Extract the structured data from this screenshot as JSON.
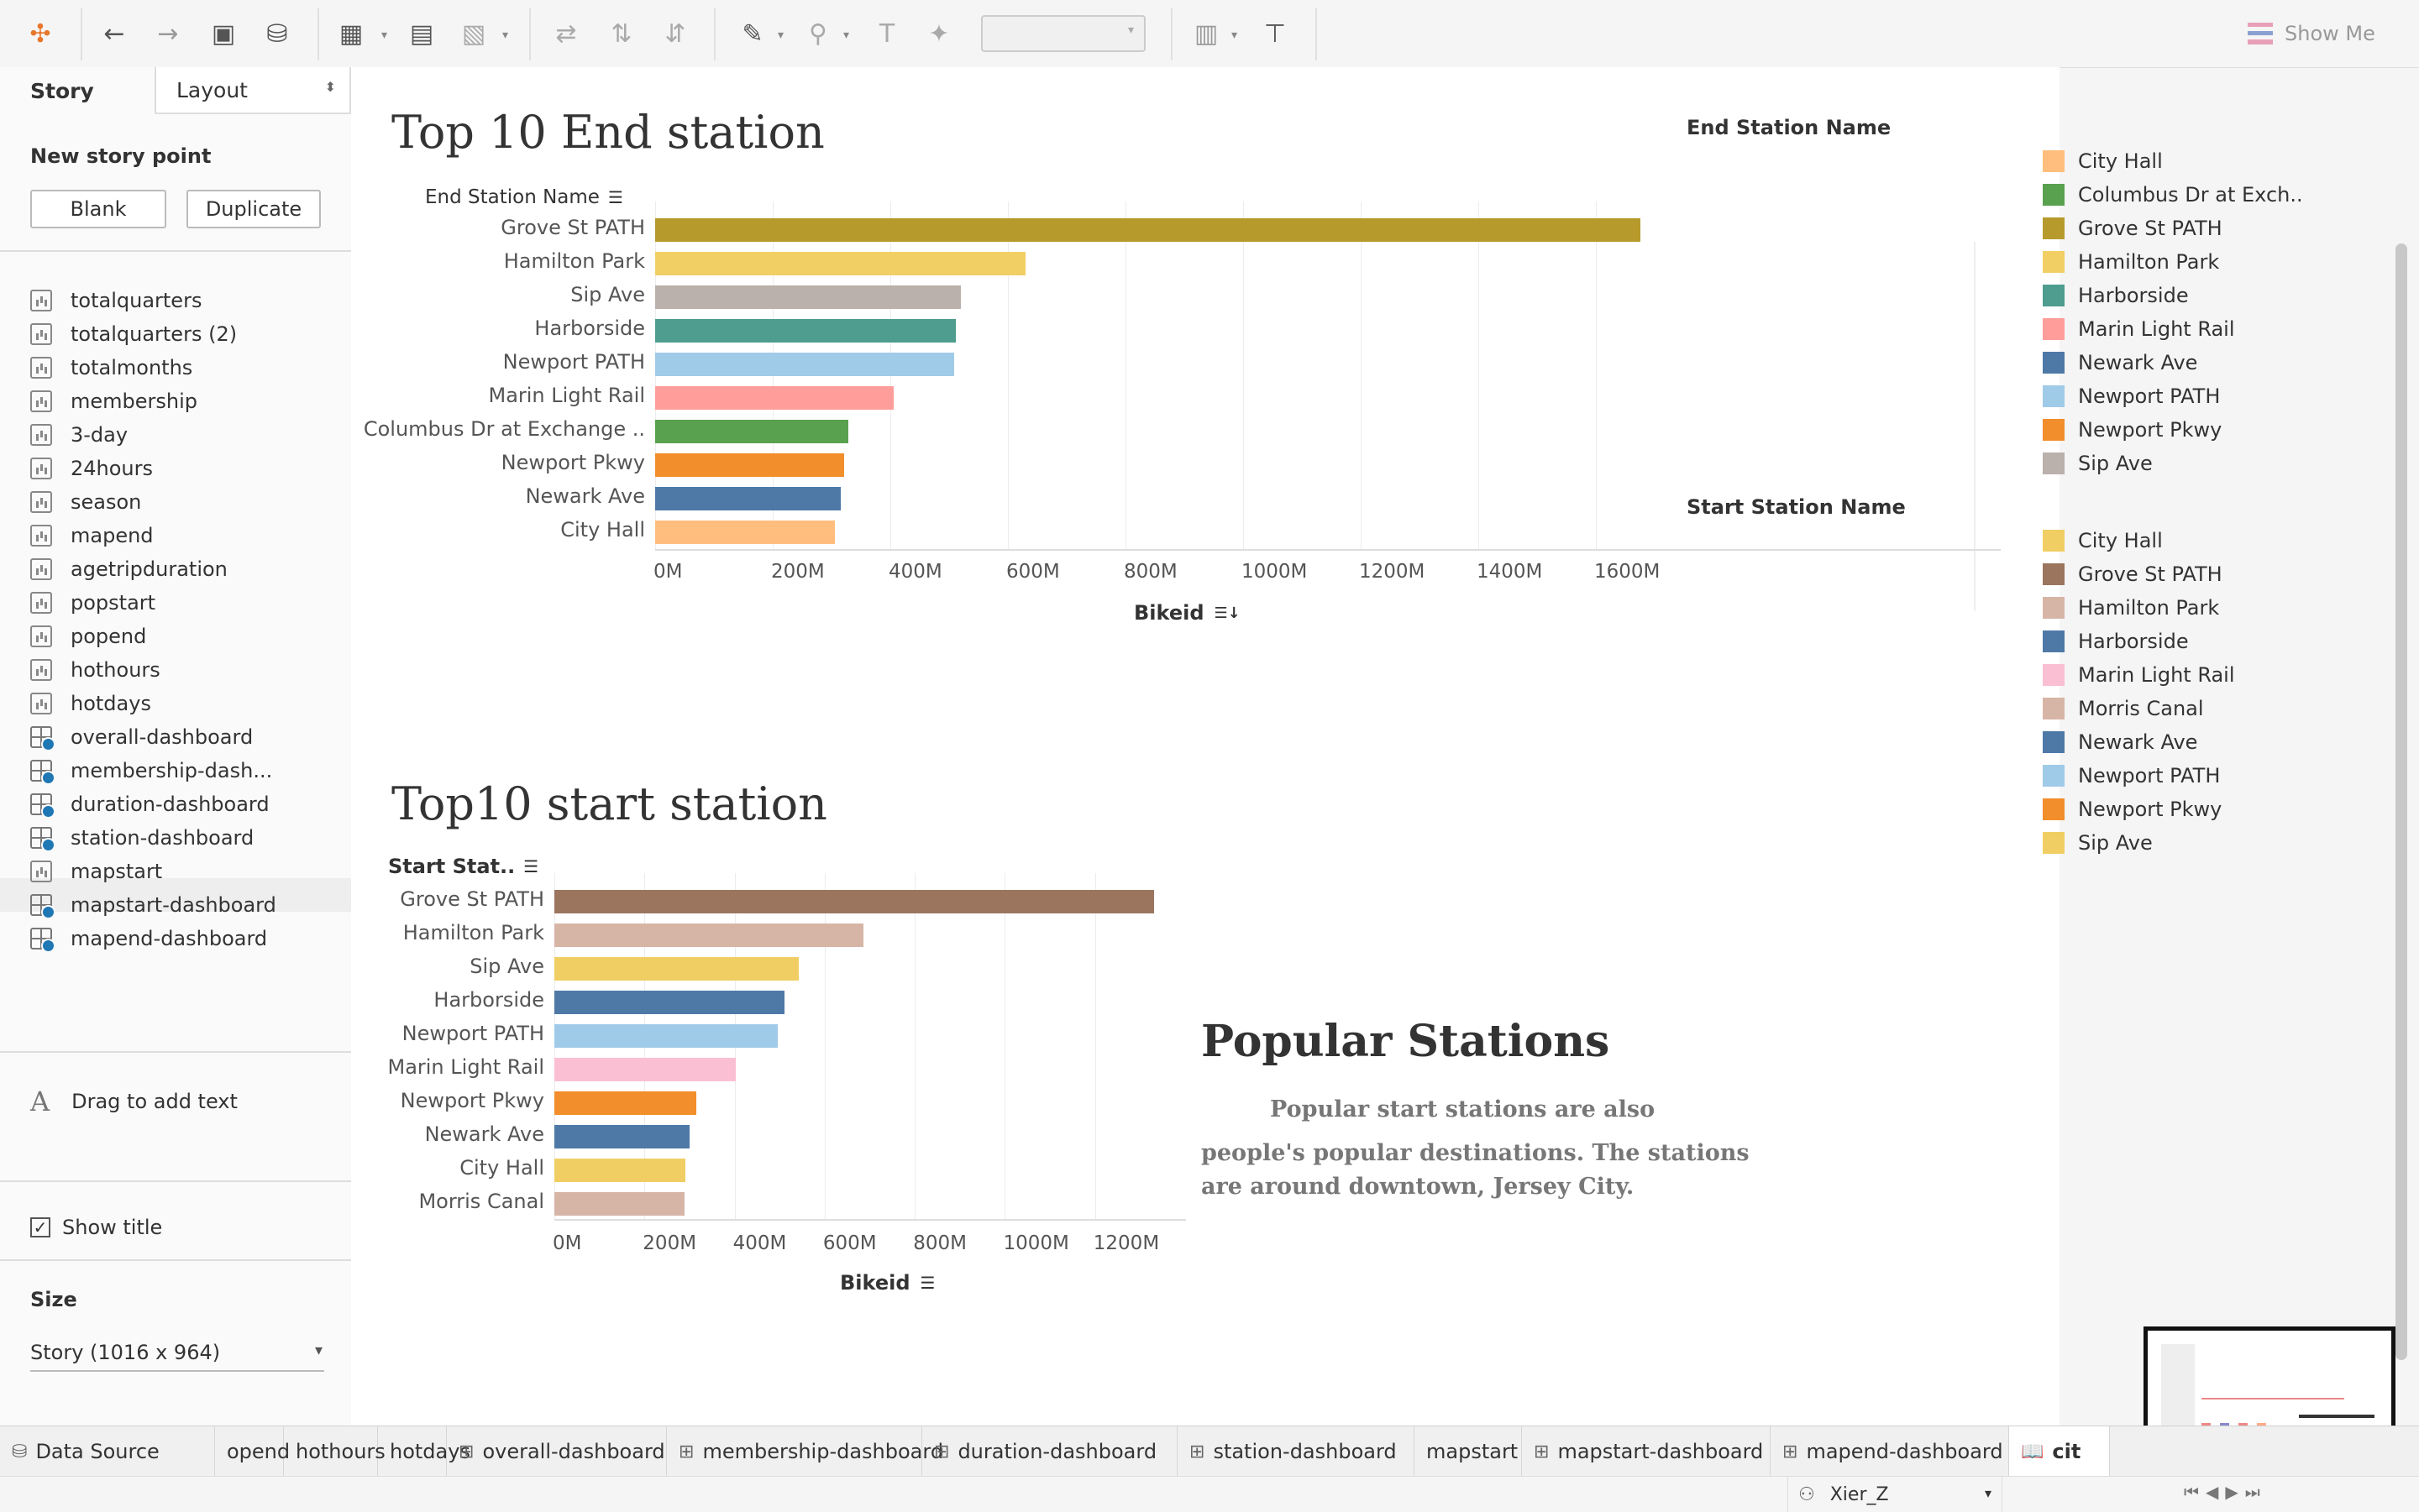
{
  "toolbar": {
    "show_me_label": "Show Me",
    "icons": [
      "tableau-logo-icon",
      "undo-icon",
      "redo-icon",
      "save-icon",
      "new-data-source-icon",
      "new-worksheet-icon",
      "duplicate-icon",
      "clear-sheet-icon",
      "swap-icon",
      "sort-ascending-icon",
      "sort-descending-icon",
      "highlight-icon",
      "group-icon",
      "label-icon",
      "pin-icon",
      "fit-dropdown",
      "show-cards-icon",
      "presentation-mode-icon"
    ]
  },
  "left_panel": {
    "tab_story": "Story",
    "tab_layout": "Layout",
    "new_story_point_label": "New story point",
    "blank_button": "Blank",
    "duplicate_button": "Duplicate",
    "sheets": [
      {
        "name": "totalquarters",
        "kind": "worksheet"
      },
      {
        "name": "totalquarters (2)",
        "kind": "worksheet"
      },
      {
        "name": "totalmonths",
        "kind": "worksheet"
      },
      {
        "name": "membership",
        "kind": "worksheet"
      },
      {
        "name": "3-day",
        "kind": "worksheet"
      },
      {
        "name": "24hours",
        "kind": "worksheet"
      },
      {
        "name": "season",
        "kind": "worksheet"
      },
      {
        "name": "mapend",
        "kind": "worksheet"
      },
      {
        "name": "agetripduration",
        "kind": "worksheet"
      },
      {
        "name": "popstart",
        "kind": "worksheet"
      },
      {
        "name": "popend",
        "kind": "worksheet"
      },
      {
        "name": "hothours",
        "kind": "worksheet"
      },
      {
        "name": "hotdays",
        "kind": "worksheet"
      },
      {
        "name": "overall-dashboard",
        "kind": "dashboard"
      },
      {
        "name": "membership-dash...",
        "kind": "dashboard"
      },
      {
        "name": "duration-dashboard",
        "kind": "dashboard"
      },
      {
        "name": "station-dashboard",
        "kind": "dashboard"
      },
      {
        "name": "mapstart",
        "kind": "worksheet"
      },
      {
        "name": "mapstart-dashboard",
        "kind": "dashboard"
      },
      {
        "name": "mapend-dashboard",
        "kind": "dashboard"
      }
    ],
    "drag_text_label": "Drag to add text",
    "show_title_label": "Show title",
    "show_title_checked": true,
    "size_heading": "Size",
    "size_value": "Story (1016 x 964)"
  },
  "chart_data": [
    {
      "type": "bar",
      "title": "Top 10 End station",
      "dimension_label": "End Station Name",
      "xlabel": "Bikeid",
      "categories": [
        "Grove St PATH",
        "Hamilton Park",
        "Sip Ave",
        "Harborside",
        "Newport PATH",
        "Marin Light Rail",
        "Columbus Dr at Exchange ..",
        "Newport Pkwy",
        "Newark Ave",
        "City Hall"
      ],
      "values": [
        1675,
        630,
        520,
        512,
        508,
        405,
        328,
        322,
        316,
        305
      ],
      "colors": [
        "#b79a2c",
        "#f2cf64",
        "#bab0ac",
        "#4e9d8f",
        "#a0cbe8",
        "#ff9d9a",
        "#59a14f",
        "#f28e2b",
        "#4e79a7",
        "#ffbe7d"
      ],
      "xticks": [
        "0M",
        "200M",
        "400M",
        "600M",
        "800M",
        "1000M",
        "1200M",
        "1400M",
        "1600M"
      ],
      "xlim": [
        0,
        1760
      ],
      "unit": "M"
    },
    {
      "type": "bar",
      "title": "Top10 start station",
      "dimension_label": "Start Stat..",
      "xlabel": "Bikeid",
      "categories": [
        "Grove St PATH",
        "Hamilton Park",
        "Sip Ave",
        "Harborside",
        "Newport PATH",
        "Marin Light Rail",
        "Newport Pkwy",
        "Newark Ave",
        "City Hall",
        "Morris Canal"
      ],
      "values": [
        1330,
        685,
        542,
        510,
        495,
        402,
        315,
        300,
        290,
        288
      ],
      "colors": [
        "#9c755f",
        "#d7b5a6",
        "#f1ce63",
        "#4e79a7",
        "#a0cbe8",
        "#fabfd2",
        "#f28e2b",
        "#4e79a7",
        "#f1ce63",
        "#d7b5a6"
      ],
      "xticks": [
        "0M",
        "200M",
        "400M",
        "600M",
        "800M",
        "1000M",
        "1200M"
      ],
      "xlim": [
        0,
        1370
      ],
      "unit": "M"
    }
  ],
  "legends": {
    "end": {
      "title": "End Station Name",
      "items": [
        {
          "label": "City Hall",
          "color": "#ffbe7d"
        },
        {
          "label": "Columbus Dr at Exch..",
          "color": "#59a14f"
        },
        {
          "label": "Grove St PATH",
          "color": "#b79a2c"
        },
        {
          "label": "Hamilton Park",
          "color": "#f2cf64"
        },
        {
          "label": "Harborside",
          "color": "#4e9d8f"
        },
        {
          "label": "Marin Light Rail",
          "color": "#ff9d9a"
        },
        {
          "label": "Newark Ave",
          "color": "#4e79a7"
        },
        {
          "label": "Newport PATH",
          "color": "#a0cbe8"
        },
        {
          "label": "Newport Pkwy",
          "color": "#f28e2b"
        },
        {
          "label": "Sip Ave",
          "color": "#bab0ac"
        }
      ]
    },
    "start": {
      "title": "Start Station Name",
      "items": [
        {
          "label": "City Hall",
          "color": "#f1ce63"
        },
        {
          "label": "Grove St PATH",
          "color": "#9c755f"
        },
        {
          "label": "Hamilton Park",
          "color": "#d7b5a6"
        },
        {
          "label": "Harborside",
          "color": "#4e79a7"
        },
        {
          "label": "Marin Light Rail",
          "color": "#fabfd2"
        },
        {
          "label": "Morris Canal",
          "color": "#d7b5a6"
        },
        {
          "label": "Newark Ave",
          "color": "#4e79a7"
        },
        {
          "label": "Newport PATH",
          "color": "#a0cbe8"
        },
        {
          "label": "Newport Pkwy",
          "color": "#f28e2b"
        },
        {
          "label": "Sip Ave",
          "color": "#f1ce63"
        }
      ]
    }
  },
  "text_box": {
    "heading": "Popular Stations",
    "body_line1": "Popular start stations are also",
    "body_line2": "people's popular destinations. The stations",
    "body_line3": "are around downtown, Jersey City."
  },
  "tabs": [
    "Data Source",
    "opend",
    "hothours",
    "hotdays",
    "overall-dashboard",
    "membership-dashboard",
    "duration-dashboard",
    "station-dashboard",
    "mapstart",
    "mapstart-dashboard",
    "mapend-dashboard",
    "cit"
  ],
  "status": {
    "user": "Xier_Z"
  }
}
